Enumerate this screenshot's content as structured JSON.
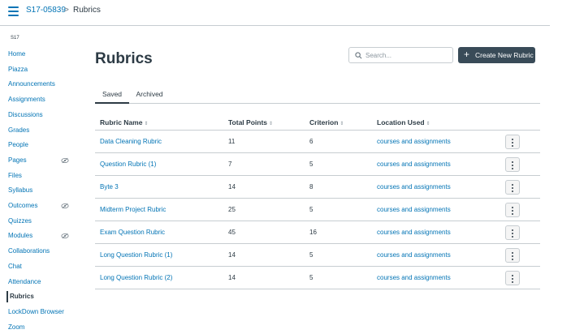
{
  "breadcrumb": {
    "course": "S17-05839",
    "separator": ">",
    "current": "Rubrics"
  },
  "sidebar": {
    "term": "S17",
    "items": [
      {
        "label": "Home",
        "hidden": false,
        "active": false
      },
      {
        "label": "Piazza",
        "hidden": false,
        "active": false
      },
      {
        "label": "Announcements",
        "hidden": false,
        "active": false
      },
      {
        "label": "Assignments",
        "hidden": false,
        "active": false
      },
      {
        "label": "Discussions",
        "hidden": false,
        "active": false
      },
      {
        "label": "Grades",
        "hidden": false,
        "active": false
      },
      {
        "label": "People",
        "hidden": false,
        "active": false
      },
      {
        "label": "Pages",
        "hidden": true,
        "active": false
      },
      {
        "label": "Files",
        "hidden": false,
        "active": false
      },
      {
        "label": "Syllabus",
        "hidden": false,
        "active": false
      },
      {
        "label": "Outcomes",
        "hidden": true,
        "active": false
      },
      {
        "label": "Quizzes",
        "hidden": false,
        "active": false
      },
      {
        "label": "Modules",
        "hidden": true,
        "active": false
      },
      {
        "label": "Collaborations",
        "hidden": false,
        "active": false
      },
      {
        "label": "Chat",
        "hidden": false,
        "active": false
      },
      {
        "label": "Attendance",
        "hidden": false,
        "active": false
      },
      {
        "label": "Rubrics",
        "hidden": false,
        "active": true
      },
      {
        "label": "LockDown Browser",
        "hidden": false,
        "active": false
      },
      {
        "label": "Zoom",
        "hidden": false,
        "active": false
      }
    ]
  },
  "main": {
    "title": "Rubrics",
    "search_placeholder": "Search...",
    "create_label": "Create New Rubric",
    "tabs": [
      {
        "label": "Saved",
        "selected": true
      },
      {
        "label": "Archived",
        "selected": false
      }
    ],
    "table": {
      "columns": [
        "Rubric Name",
        "Total Points",
        "Criterion",
        "Location Used"
      ],
      "sort_glyph": "⇕",
      "rows": [
        {
          "name": "Data Cleaning Rubric",
          "points": "11",
          "criterion": "6",
          "location": "courses and assignments"
        },
        {
          "name": "Question Rubric (1)",
          "points": "7",
          "criterion": "5",
          "location": "courses and assignments"
        },
        {
          "name": "Byte 3",
          "points": "14",
          "criterion": "8",
          "location": "courses and assignments"
        },
        {
          "name": "Midterm Project Rubric",
          "points": "25",
          "criterion": "5",
          "location": "courses and assignments"
        },
        {
          "name": "Exam Question Rubric",
          "points": "45",
          "criterion": "16",
          "location": "courses and assignments"
        },
        {
          "name": "Long Question Rubric (1)",
          "points": "14",
          "criterion": "5",
          "location": "courses and assignments"
        },
        {
          "name": "Long Question Rubric (2)",
          "points": "14",
          "criterion": "5",
          "location": "courses and assignments"
        }
      ]
    }
  },
  "icons": {
    "menu": "hamburger-icon",
    "search": "search-icon",
    "create": "plus-icon",
    "hidden": "eye-slash-icon",
    "row_menu": "kebab-icon"
  },
  "colors": {
    "link": "#0374b5",
    "text": "#2d3b45",
    "button_dark": "#394b58",
    "border": "#c7cdd1"
  }
}
